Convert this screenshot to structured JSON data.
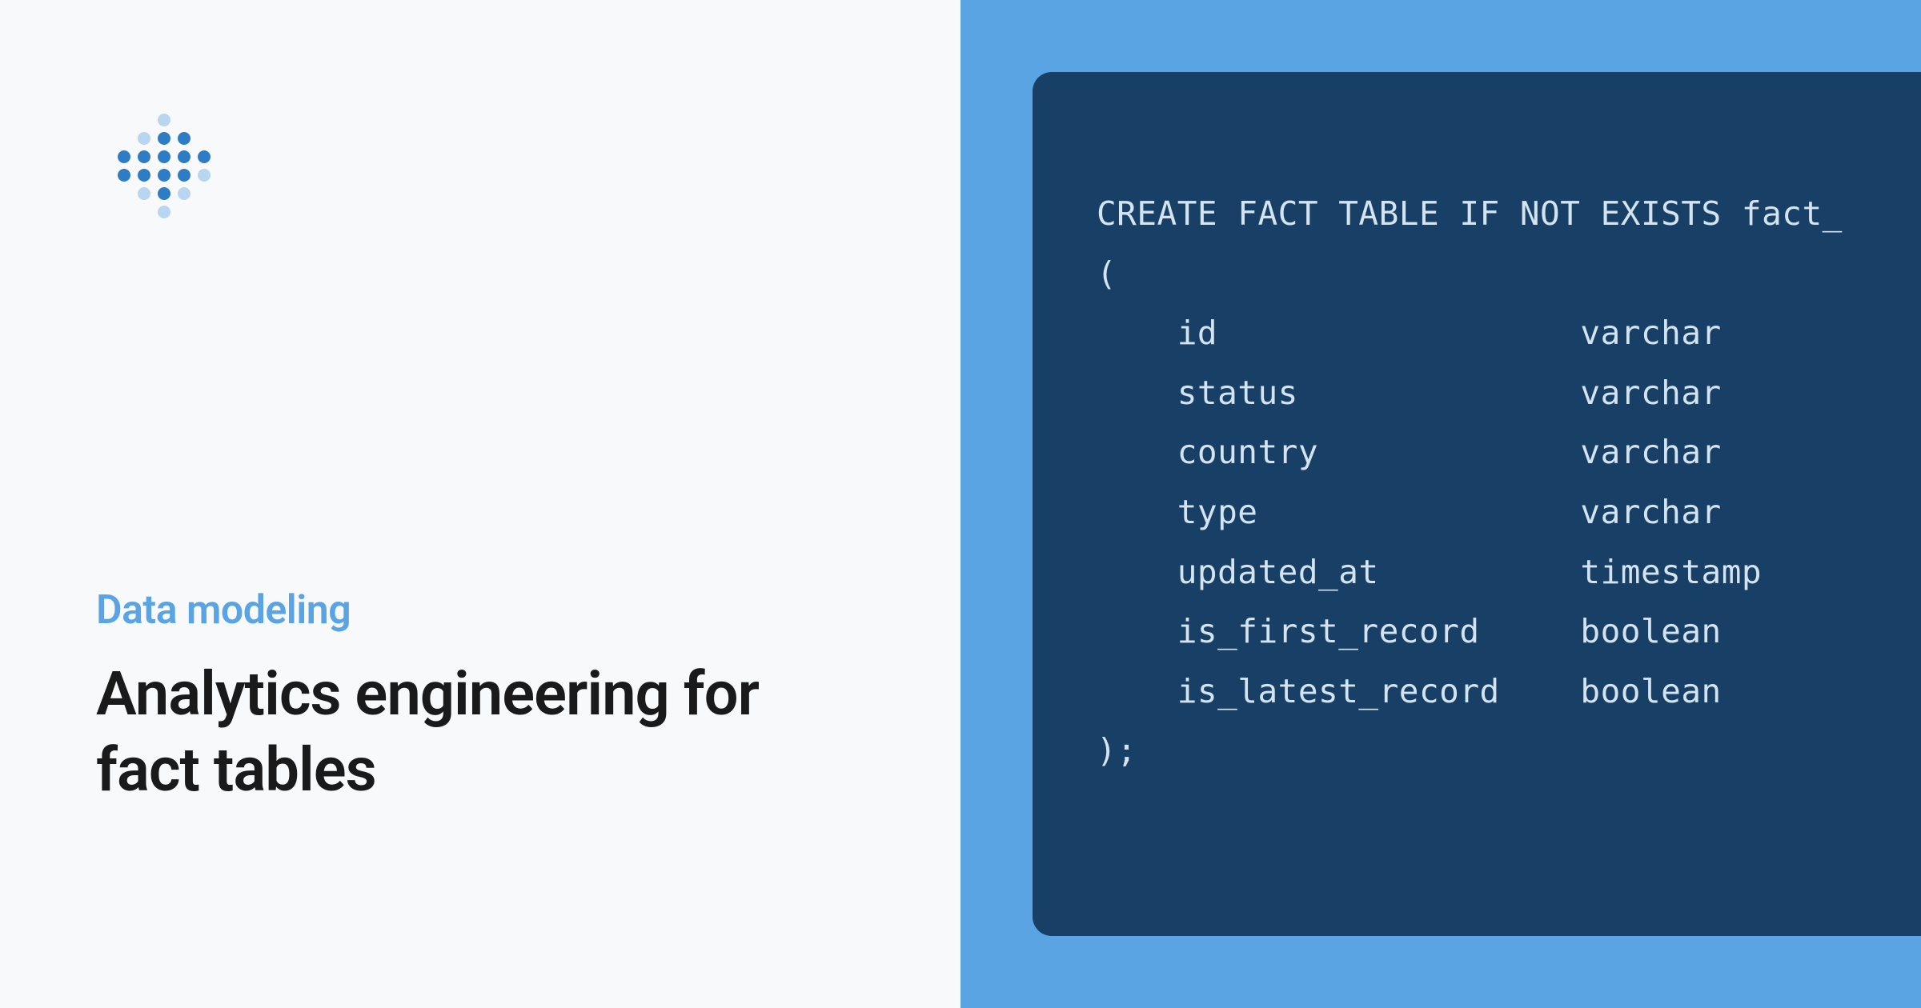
{
  "category": "Data modeling",
  "title": "Analytics engineering for fact tables",
  "code": {
    "line1": "CREATE FACT TABLE IF NOT EXISTS fact_",
    "line2": "(",
    "cols": [
      {
        "name": "id",
        "type": "varchar"
      },
      {
        "name": "status",
        "type": "varchar"
      },
      {
        "name": "country",
        "type": "varchar"
      },
      {
        "name": "type",
        "type": "varchar"
      },
      {
        "name": "updated_at",
        "type": "timestamp"
      },
      {
        "name": "is_first_record",
        "type": "boolean"
      },
      {
        "name": "is_latest_record",
        "type": "boolean"
      }
    ],
    "line_end": ");"
  }
}
